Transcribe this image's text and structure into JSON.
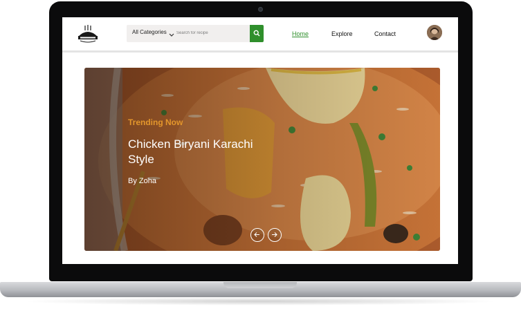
{
  "nav": {
    "category_label": "All Categories",
    "search_placeholder": "Search for recipe",
    "links": [
      {
        "label": "Home",
        "active": true
      },
      {
        "label": "Explore",
        "active": false
      },
      {
        "label": "Contact",
        "active": false
      }
    ]
  },
  "hero": {
    "tag": "Trending Now",
    "title": "Chicken Biryani Karachi Style",
    "author": "By Zoha"
  },
  "colors": {
    "accent_green": "#2f8f2c",
    "trend_orange": "#e3962c",
    "laptop_bezel": "#0b0b0c"
  },
  "icons": [
    "logo",
    "chevron-down-icon",
    "search-icon",
    "avatar",
    "arrow-left-icon",
    "arrow-right-icon",
    "camera"
  ]
}
